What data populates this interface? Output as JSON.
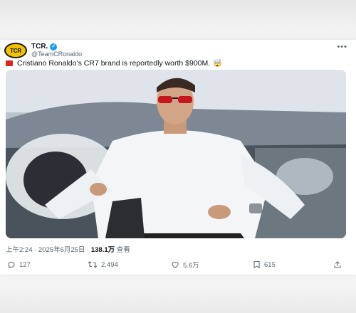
{
  "tweet": {
    "author_name": "TCR.",
    "avatar_text": "TCR",
    "handle": "@TeamCRonaldo",
    "more_label": "•••",
    "text": "Cristiano Ronaldo’s CR7 brand is reportedly worth $900M.",
    "emoji": "🤯",
    "time": "上午2:24 · 2025年6月25日 · ",
    "views_count": "138.1万",
    "views_label": " 查看"
  },
  "actions": {
    "replies": "127",
    "retweets": "2,494",
    "likes": "5.6万",
    "bookmarks": "615"
  },
  "icons": [
    "verified-badge-icon",
    "reply-icon",
    "retweet-icon",
    "like-icon",
    "bookmark-icon",
    "share-icon",
    "flag-icon"
  ],
  "colors": {
    "verified": "#1d9bf0",
    "avatar_bg": "#f2c200",
    "text_primary": "#0f1419",
    "text_secondary": "#536471"
  }
}
